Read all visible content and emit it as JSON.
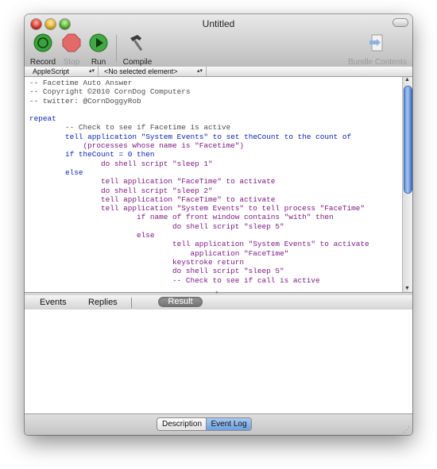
{
  "window": {
    "title": "Untitled"
  },
  "toolbar": {
    "record": "Record",
    "stop": "Stop",
    "run": "Run",
    "compile": "Compile",
    "bundle": "Bundle Contents"
  },
  "navbar": {
    "language": "AppleScript",
    "element": "<No selected element>"
  },
  "script_lines": [
    {
      "indent": 0,
      "parts": [
        {
          "t": "-- Facetime Auto Answer",
          "c": "comment"
        }
      ]
    },
    {
      "indent": 0,
      "parts": [
        {
          "t": "-- Copyright ©2010 CornDog Computers",
          "c": "comment"
        }
      ]
    },
    {
      "indent": 0,
      "parts": [
        {
          "t": "-- twitter: @CornDoggyRob",
          "c": "comment"
        }
      ]
    },
    {
      "indent": 0,
      "parts": []
    },
    {
      "indent": 0,
      "parts": [
        {
          "t": "repeat",
          "c": "key"
        }
      ]
    },
    {
      "indent": 1,
      "parts": [
        {
          "t": "-- Check to see if Facetime is active",
          "c": "comment"
        }
      ]
    },
    {
      "indent": 1,
      "parts": [
        {
          "t": "tell",
          "c": "key"
        },
        {
          "t": " application \"System Events\" ",
          "c": "str"
        },
        {
          "t": "to set theCount to the count of",
          "c": "key"
        }
      ]
    },
    {
      "indent": 1,
      "extra": "    ",
      "parts": [
        {
          "t": "(processes whose name is \"Facetime\")",
          "c": "app"
        }
      ]
    },
    {
      "indent": 1,
      "parts": [
        {
          "t": "if theCount = 0 then",
          "c": "key"
        }
      ]
    },
    {
      "indent": 2,
      "parts": [
        {
          "t": "do shell script \"sleep 1\"",
          "c": "app"
        }
      ]
    },
    {
      "indent": 1,
      "parts": [
        {
          "t": "else",
          "c": "key"
        }
      ]
    },
    {
      "indent": 2,
      "parts": [
        {
          "t": "tell application \"FaceTime\" to activate",
          "c": "app"
        }
      ]
    },
    {
      "indent": 2,
      "parts": [
        {
          "t": "do shell script \"sleep 2\"",
          "c": "app"
        }
      ]
    },
    {
      "indent": 2,
      "parts": [
        {
          "t": "tell application \"FaceTime\" to activate",
          "c": "app"
        }
      ]
    },
    {
      "indent": 2,
      "parts": [
        {
          "t": "tell application \"System Events\" to tell process \"FaceTime\"",
          "c": "app"
        }
      ]
    },
    {
      "indent": 3,
      "parts": [
        {
          "t": "if name of front window contains \"with\" then",
          "c": "app"
        }
      ]
    },
    {
      "indent": 4,
      "parts": [
        {
          "t": "do shell script \"sleep 5\"",
          "c": "app"
        }
      ]
    },
    {
      "indent": 3,
      "parts": [
        {
          "t": "else",
          "c": "app"
        }
      ]
    },
    {
      "indent": 4,
      "parts": [
        {
          "t": "tell application \"System Events\" to activate",
          "c": "app"
        }
      ]
    },
    {
      "indent": 4,
      "extra": "    ",
      "parts": [
        {
          "t": "application \"FaceTime\"",
          "c": "app"
        }
      ]
    },
    {
      "indent": 4,
      "parts": [
        {
          "t": "keystroke return",
          "c": "app"
        }
      ]
    },
    {
      "indent": 4,
      "parts": [
        {
          "t": "do shell script \"sleep 5\"",
          "c": "app"
        }
      ]
    },
    {
      "indent": 4,
      "parts": [
        {
          "t": "-- Check to see if call is active",
          "c": "app"
        }
      ]
    }
  ],
  "colors": {
    "comment": "#4c4e4e",
    "key": "#0b26b1",
    "str": "#0b26b1",
    "app": "#7b1a80"
  },
  "tabs": {
    "events": "Events",
    "replies": "Replies",
    "result": "Result"
  },
  "bottom": {
    "description": "Description",
    "event_log": "Event Log"
  }
}
